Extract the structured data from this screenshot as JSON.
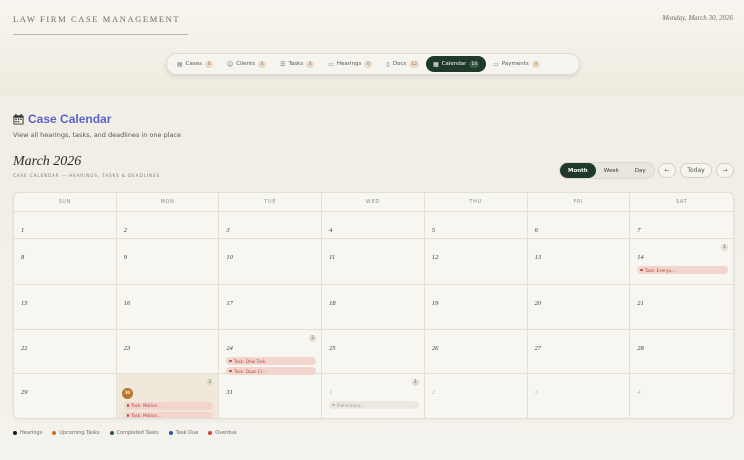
{
  "app": {
    "brand": "LAW FIRM CASE MANAGEMENT",
    "date": "Monday, March 30, 2026"
  },
  "nav": [
    {
      "label": "Cases",
      "count": "0",
      "icon": "cases-icon",
      "glyph": "▤",
      "active": false
    },
    {
      "label": "Clients",
      "count": "4",
      "icon": "clients-icon",
      "glyph": "☺",
      "active": false
    },
    {
      "label": "Tasks",
      "count": "4",
      "icon": "tasks-icon",
      "glyph": "☰",
      "active": false
    },
    {
      "label": "Hearings",
      "count": "0",
      "icon": "hearings-icon",
      "glyph": "▭",
      "active": false
    },
    {
      "label": "Docs",
      "count": "12",
      "icon": "docs-icon",
      "glyph": "▯",
      "active": false
    },
    {
      "label": "Calendar",
      "count": "14",
      "icon": "calendar-icon",
      "glyph": "▦",
      "active": true
    },
    {
      "label": "Payments",
      "count": "4",
      "icon": "payments-icon",
      "glyph": "▭",
      "active": false
    }
  ],
  "page": {
    "title": "Case Calendar",
    "subtitle": "View all hearings, tasks, and deadlines in one place"
  },
  "calendar": {
    "month_title": "March 2026",
    "month_subtitle": "CASE CALENDAR — HEARINGS, TASKS & DEADLINES",
    "views": [
      "Month",
      "Week",
      "Day"
    ],
    "active_view": "Month",
    "prev": "←",
    "today": "Today",
    "next": "→",
    "weekdays": [
      "SUN",
      "MON",
      "TUE",
      "WED",
      "THU",
      "FRI",
      "SAT"
    ],
    "days": [
      {
        "n": "1"
      },
      {
        "n": "2"
      },
      {
        "n": "3"
      },
      {
        "n": "4"
      },
      {
        "n": "5"
      },
      {
        "n": "6"
      },
      {
        "n": "7"
      },
      {
        "n": "8"
      },
      {
        "n": "9"
      },
      {
        "n": "10"
      },
      {
        "n": "11"
      },
      {
        "n": "12"
      },
      {
        "n": "13"
      },
      {
        "n": "14",
        "count": "1",
        "events": [
          {
            "label": "Task: Everyo..."
          }
        ]
      },
      {
        "n": "15"
      },
      {
        "n": "16"
      },
      {
        "n": "17"
      },
      {
        "n": "18"
      },
      {
        "n": "19"
      },
      {
        "n": "20"
      },
      {
        "n": "21"
      },
      {
        "n": "22"
      },
      {
        "n": "23"
      },
      {
        "n": "24",
        "count": "2",
        "events": [
          {
            "label": "Task: Qhw Task"
          },
          {
            "label": "Task: Duac Cr..."
          }
        ]
      },
      {
        "n": "25"
      },
      {
        "n": "26"
      },
      {
        "n": "27"
      },
      {
        "n": "28"
      },
      {
        "n": "29"
      },
      {
        "n": "30",
        "today": true,
        "count": "2",
        "events": [
          {
            "label": "Task: Motion..."
          },
          {
            "label": "Task: Motion..."
          }
        ]
      },
      {
        "n": "31"
      },
      {
        "n": "1",
        "other": true,
        "count": "1",
        "events": [
          {
            "label": "Preliminary...",
            "faded": true
          }
        ]
      },
      {
        "n": "2",
        "other": true
      },
      {
        "n": "3",
        "other": true
      },
      {
        "n": "4",
        "other": true
      }
    ]
  },
  "legend": [
    {
      "label": "Hearings",
      "color": "#1a1a1a"
    },
    {
      "label": "Upcoming Tasks",
      "color": "#c8722e"
    },
    {
      "label": "Completed Tasks",
      "color": "#2f5a3e"
    },
    {
      "label": "Task Due",
      "color": "#2a56a6"
    },
    {
      "label": "Overdue",
      "color": "#c9473a"
    }
  ]
}
